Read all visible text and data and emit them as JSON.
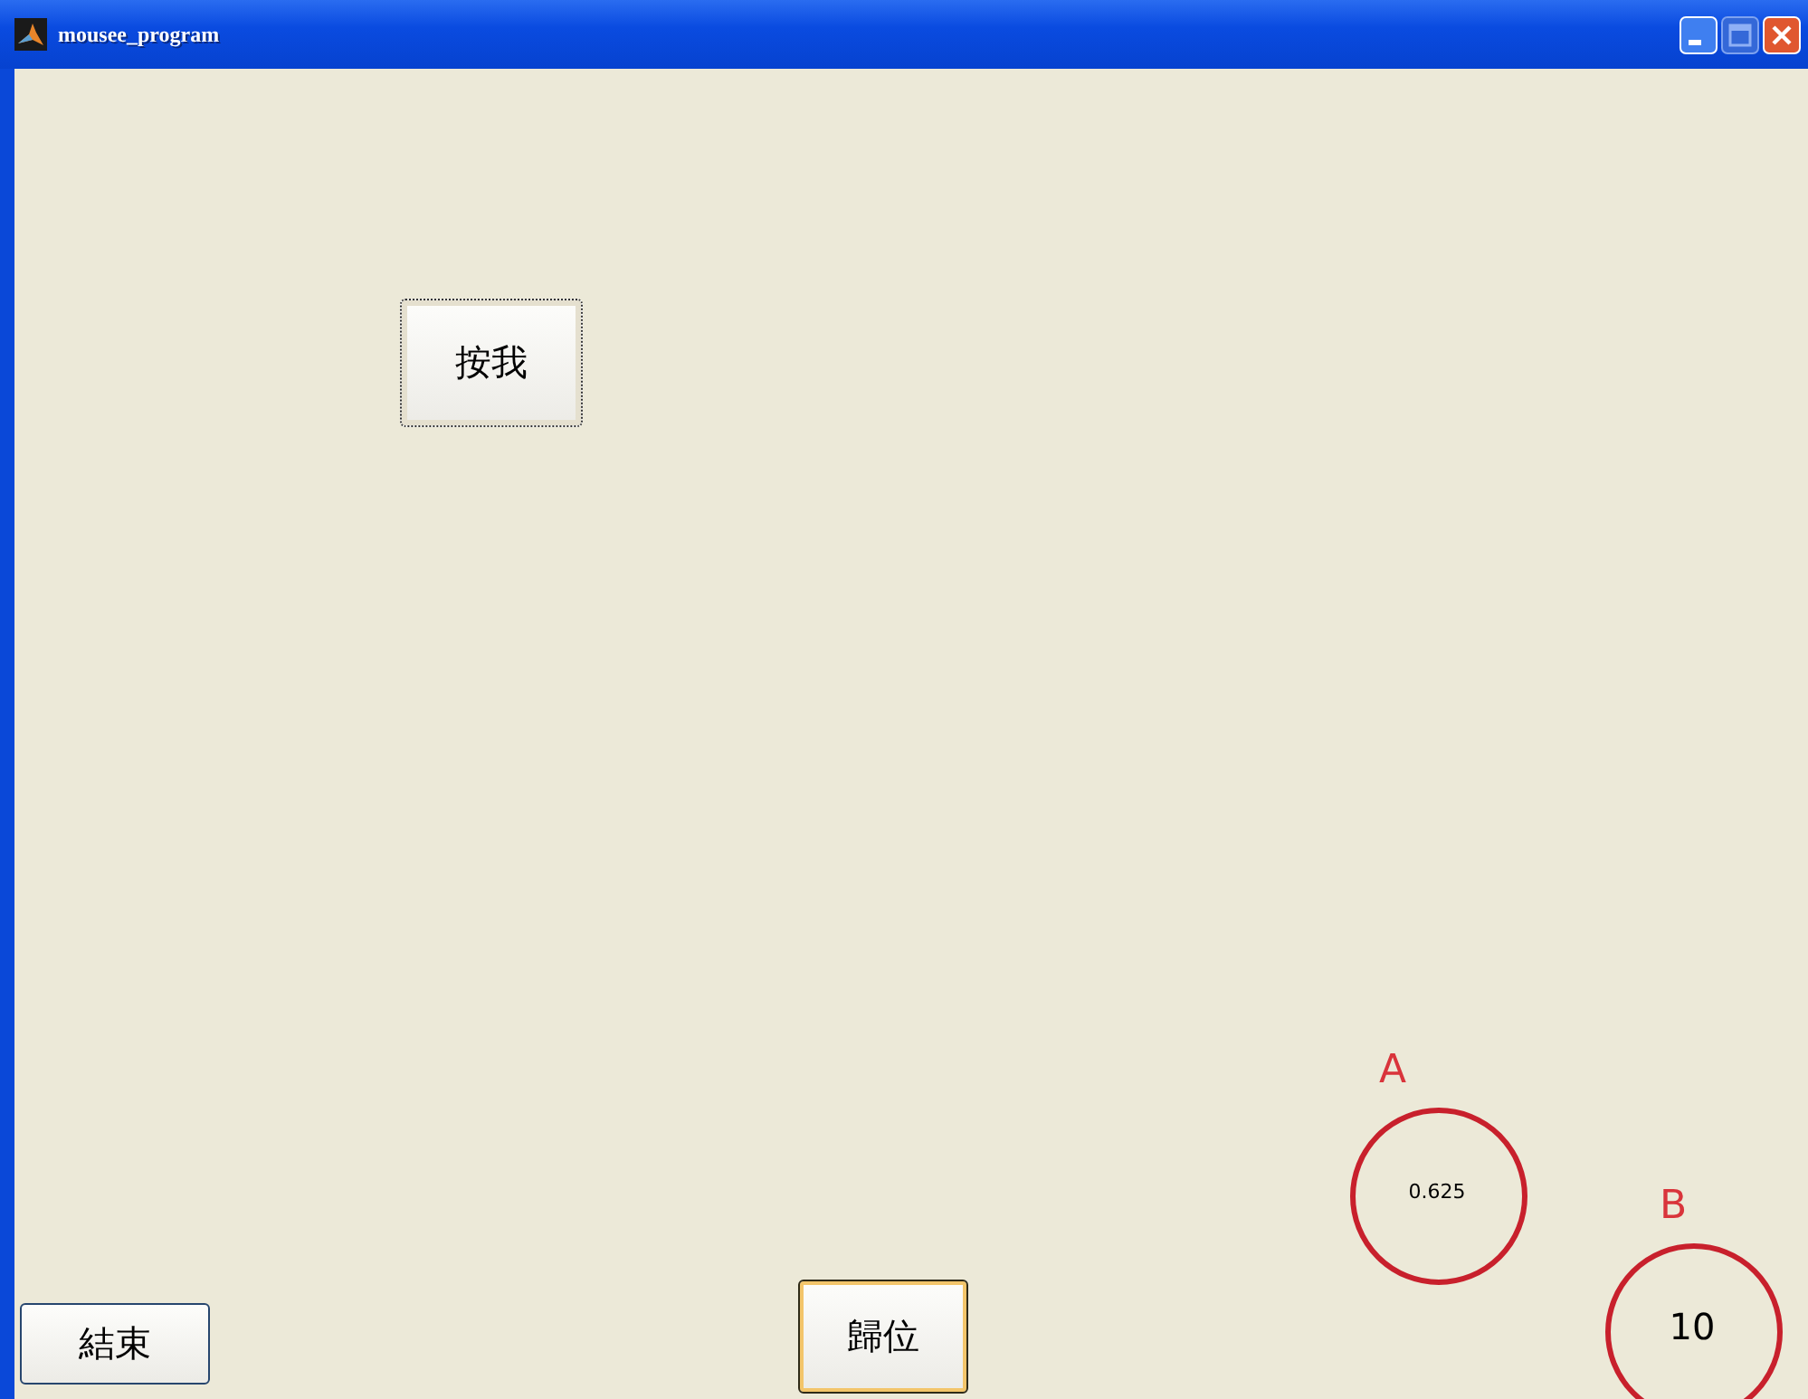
{
  "window": {
    "title": "mousee_program"
  },
  "buttons": [
    {
      "label": "按我",
      "focused": true,
      "hovered": false
    },
    {
      "label": "結束",
      "focused": false,
      "hovered": false
    },
    {
      "label": "歸位",
      "focused": false,
      "hovered": true
    }
  ],
  "readouts": [
    {
      "label": "A",
      "value": "0.625",
      "kind": "small"
    },
    {
      "label": "B",
      "value": "10",
      "kind": "large"
    }
  ]
}
